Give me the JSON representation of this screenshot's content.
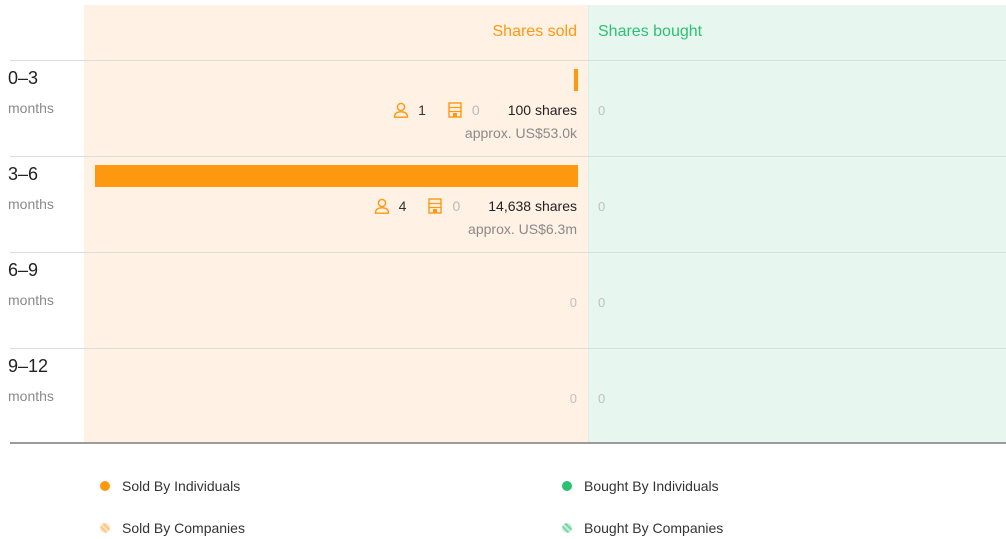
{
  "chart_data": {
    "type": "bar",
    "orientation": "horizontal",
    "columns": {
      "sold": "Shares sold",
      "bought": "Shares bought"
    },
    "unit_label": "months",
    "categories": [
      "0–3",
      "3–6",
      "6–9",
      "9–12"
    ],
    "rows": [
      {
        "period": "0–3",
        "sold": {
          "individuals": "1",
          "companies": "0",
          "shares": "100 shares",
          "shares_value": 100,
          "approx": "approx. US$53.0k"
        },
        "bought": {
          "value": "0"
        }
      },
      {
        "period": "3–6",
        "sold": {
          "individuals": "4",
          "companies": "0",
          "shares": "14,638 shares",
          "shares_value": 14638,
          "approx": "approx. US$6.3m"
        },
        "bought": {
          "value": "0"
        }
      },
      {
        "period": "6–9",
        "sold": {
          "value": "0",
          "shares_value": 0
        },
        "bought": {
          "value": "0"
        }
      },
      {
        "period": "9–12",
        "sold": {
          "value": "0",
          "shares_value": 0
        },
        "bought": {
          "value": "0"
        }
      }
    ],
    "legend": [
      {
        "label": "Sold By Individuals",
        "color": "#ff9811",
        "pattern": "solid"
      },
      {
        "label": "Sold By Companies",
        "color": "#ffc684",
        "pattern": "hatched"
      },
      {
        "label": "Bought By Individuals",
        "color": "#2cc073",
        "pattern": "solid"
      },
      {
        "label": "Bought By Companies",
        "color": "#74d6a4",
        "pattern": "hatched"
      }
    ],
    "colors": {
      "sold": "#ff9811",
      "bought": "#2cc073",
      "sold_bg": "#fff1e3",
      "bought_bg": "#e7f7ef"
    }
  }
}
